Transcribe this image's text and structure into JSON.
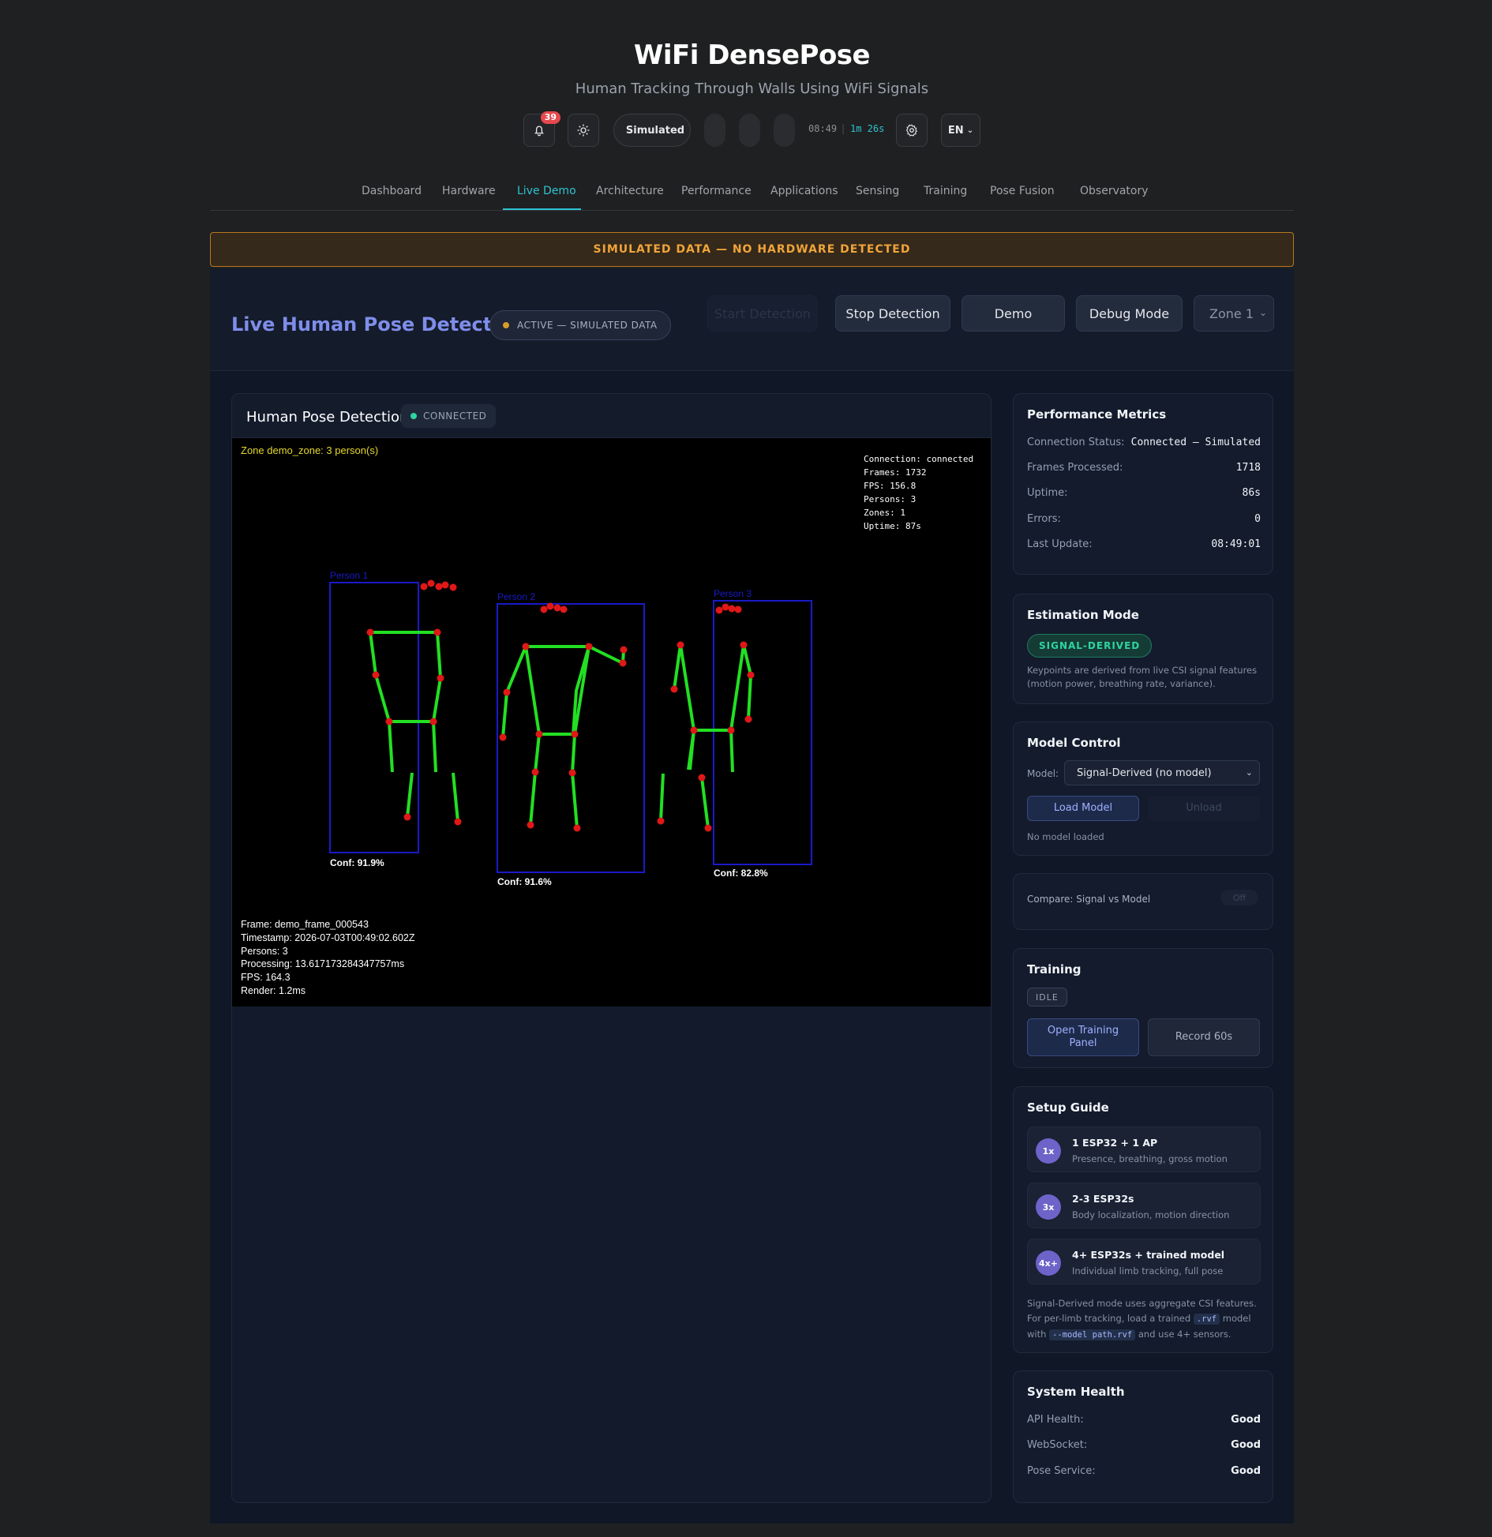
{
  "header": {
    "title": "WiFi DensePose",
    "subtitle": "Human Tracking Through Walls Using WiFi Signals",
    "notification_count": "39",
    "mode_label": "Simulated",
    "clock": "08:49",
    "uptime": "1m 26s",
    "language": "EN"
  },
  "nav": {
    "tabs": [
      "Dashboard",
      "Hardware",
      "Live Demo",
      "Architecture",
      "Performance",
      "Applications",
      "Sensing",
      "Training",
      "Pose Fusion",
      "Observatory"
    ],
    "active": "Live Demo"
  },
  "banner": "SIMULATED DATA — NO HARDWARE DETECTED",
  "demo": {
    "title": "Live Human Pose Detection",
    "status": "ACTIVE — SIMULATED DATA",
    "buttons": {
      "start": "Start Detection",
      "stop": "Stop Detection",
      "demo": "Demo",
      "debug": "Debug Mode"
    },
    "zone_select": "Zone 1"
  },
  "pose_card": {
    "title": "Human Pose Detection",
    "connection": "CONNECTED",
    "zone_label": "Zone demo_zone: 3 person(s)",
    "overlay_stats": [
      "Connection: connected",
      "Frames: 1732",
      "FPS: 156.8",
      "Persons: 3",
      "Zones: 1",
      "Uptime: 87s"
    ],
    "frame_info": [
      "Frame: demo_frame_000543",
      "Timestamp: 2026-07-03T00:49:02.602Z",
      "Persons: 3",
      "Processing: 13.617173284347757ms",
      "FPS: 164.3",
      "Render: 1.2ms"
    ],
    "persons": [
      {
        "label": "Person 1",
        "confidence": "Conf: 91.9%"
      },
      {
        "label": "Person 2",
        "confidence": "Conf: 91.6%"
      },
      {
        "label": "Person 3",
        "confidence": "Conf: 82.8%"
      }
    ]
  },
  "performance": {
    "title": "Performance Metrics",
    "rows": [
      {
        "label": "Connection Status:",
        "value": "Connected — Simulated"
      },
      {
        "label": "Frames Processed:",
        "value": "1718"
      },
      {
        "label": "Uptime:",
        "value": "86s"
      },
      {
        "label": "Errors:",
        "value": "0"
      },
      {
        "label": "Last Update:",
        "value": "08:49:01"
      }
    ]
  },
  "estimation": {
    "title": "Estimation Mode",
    "tag": "SIGNAL-DERIVED",
    "desc": "Keypoints are derived from live CSI signal features (motion power, breathing rate, variance)."
  },
  "model_control": {
    "title": "Model Control",
    "model_label": "Model:",
    "model_value": "Signal-Derived (no model)",
    "load": "Load Model",
    "unload": "Unload",
    "status": "No model loaded"
  },
  "compare": {
    "label": "Compare: Signal vs Model",
    "toggle": "Off"
  },
  "training": {
    "title": "Training",
    "state": "IDLE",
    "open_panel": "Open Training Panel",
    "record": "Record 60s"
  },
  "setup_guide": {
    "title": "Setup Guide",
    "items": [
      {
        "badge": "1x",
        "title": "1 ESP32 + 1 AP",
        "desc": "Presence, breathing, gross motion"
      },
      {
        "badge": "3x",
        "title": "2-3 ESP32s",
        "desc": "Body localization, motion direction"
      },
      {
        "badge": "4x+",
        "title": "4+ ESP32s + trained model",
        "desc": "Individual limb tracking, full pose"
      }
    ],
    "note_a": "Signal-Derived mode uses aggregate CSI features. For per-limb tracking, load a trained",
    "note_code1": ".rvf",
    "note_b": "model with",
    "note_code2": "--model path.rvf",
    "note_c": "and use 4+ sensors."
  },
  "health": {
    "title": "System Health",
    "rows": [
      {
        "label": "API Health:",
        "value": "Good"
      },
      {
        "label": "WebSocket:",
        "value": "Good"
      },
      {
        "label": "Pose Service:",
        "value": "Good"
      }
    ]
  },
  "colors": {
    "accent": "#2fc3d3",
    "title_purple": "#7f8dea",
    "skeleton": "#22e022",
    "keypoint": "#e01818",
    "bbox": "#1a1ac8",
    "warning": "#f0a43a"
  }
}
